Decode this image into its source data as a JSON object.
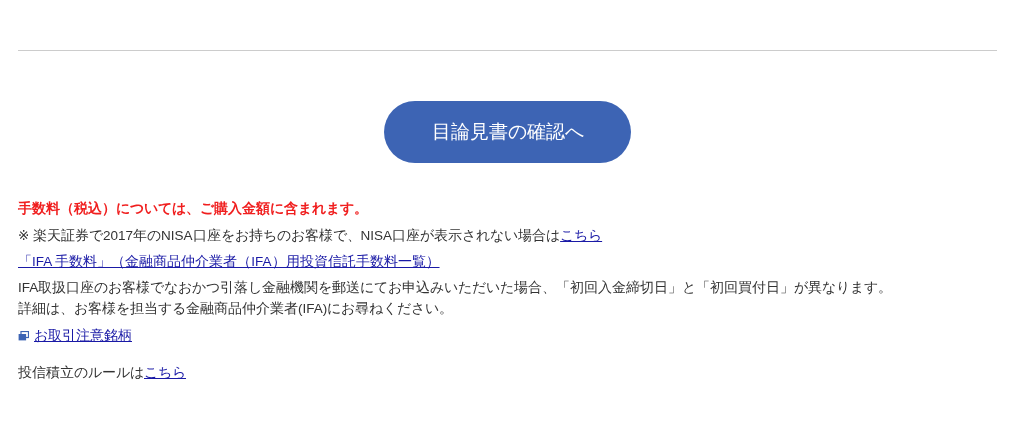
{
  "button": {
    "label": "目論見書の確認へ"
  },
  "fee_notice": "手数料（税込）については、ご購入金額に含まれます。",
  "nisa_note": {
    "text": "※ 楽天証券で2017年のNISA口座をお持ちのお客様で、NISA口座が表示されない場合は",
    "link": "こちら"
  },
  "ifa_fee_link": "「IFA 手数料」（金融商品仲介業者（IFA）用投資信託手数料一覧）",
  "ifa_notes": [
    "IFA取扱口座のお客様でなおかつ引落し金融機関を郵送にてお申込みいただいた場合、「初回入金締切日」と「初回買付日」が異なります。",
    "詳細は、お客様を担当する金融商品仲介業者(IFA)にお尋ねください。"
  ],
  "caution_link": {
    "label": "お取引注意銘柄"
  },
  "rule_note": {
    "text": "投信積立のルールは",
    "link": "こちら"
  }
}
